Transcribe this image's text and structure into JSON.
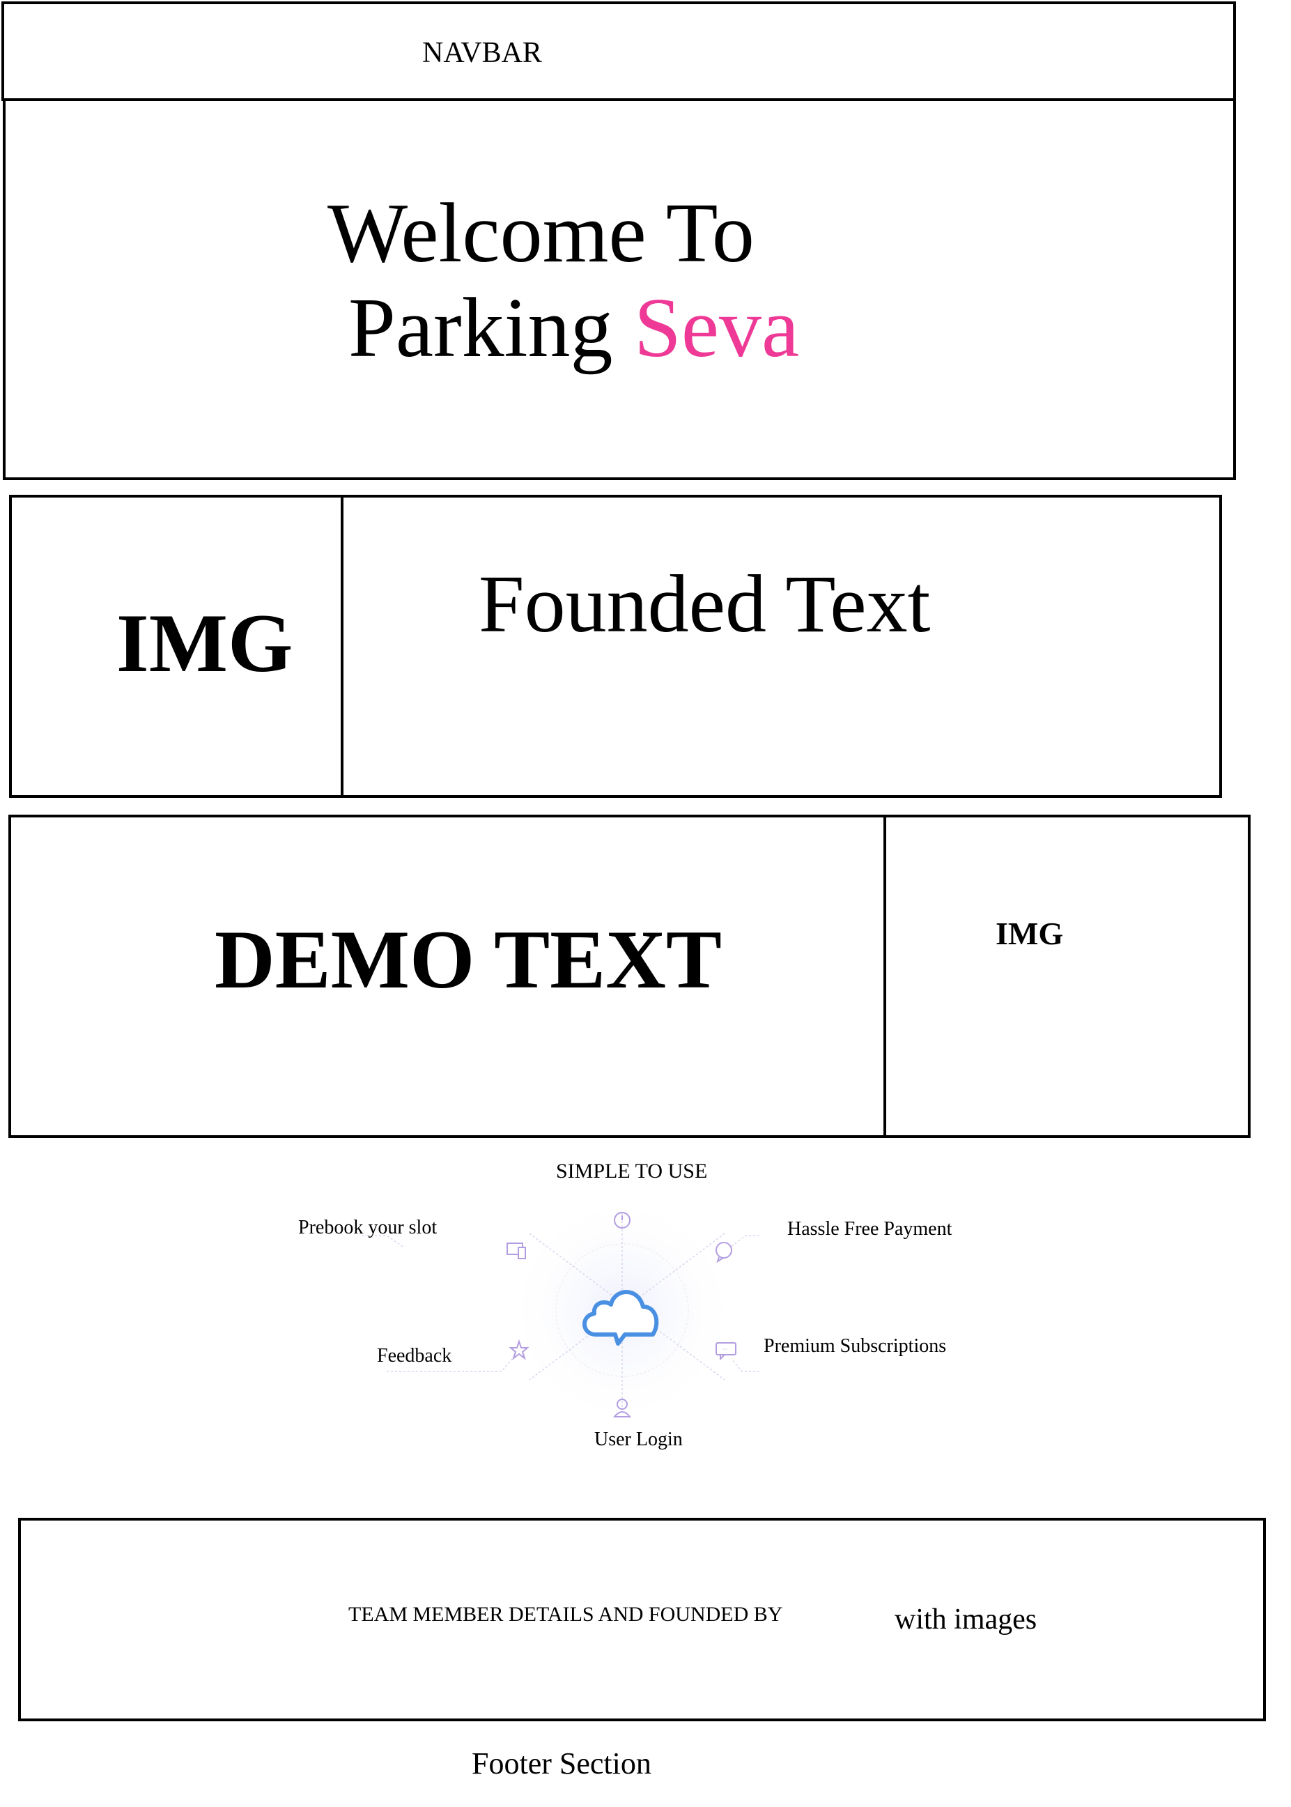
{
  "navbar": {
    "label": "NAVBAR"
  },
  "hero": {
    "line1": "Welcome To",
    "line2_prefix": "Parking",
    "line2_accent": "Seva",
    "accent_color": "#ee3a96"
  },
  "founded": {
    "img_label": "IMG",
    "text": "Founded Text"
  },
  "demo": {
    "text": "DEMO TEXT",
    "img_label": "IMG"
  },
  "features": {
    "title": "SIMPLE TO USE",
    "center_icon": "cloud-chat-icon",
    "items": [
      {
        "label": "Prebook your slot",
        "icon": "devices-icon"
      },
      {
        "label": "Hassle Free Payment",
        "icon": "chat-bubble-icon"
      },
      {
        "label": "Feedback",
        "icon": "star-icon"
      },
      {
        "label": "Premium Subscriptions",
        "icon": "message-icon"
      },
      {
        "label": "User Login",
        "icon": "user-icon"
      }
    ],
    "top_icon": "timer-icon"
  },
  "team": {
    "text": "TEAM MEMBER DETAILS AND FOUNDED BY",
    "subtext": "with images"
  },
  "footer": {
    "label": "Footer Section"
  }
}
